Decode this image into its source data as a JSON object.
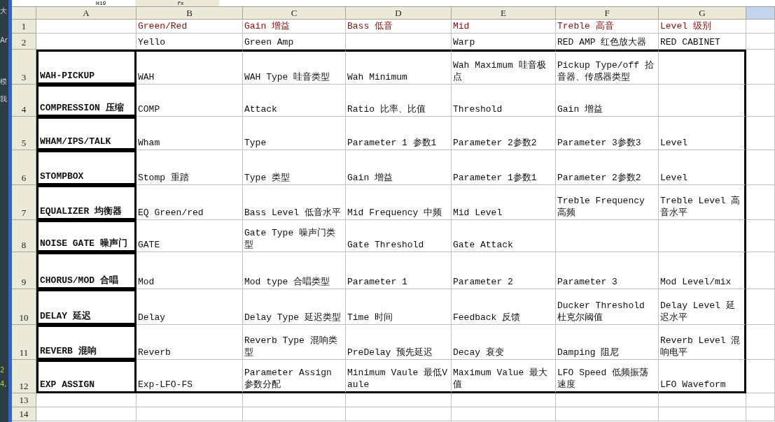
{
  "formula_bar": {
    "name_box": "H19",
    "function_label": "fx"
  },
  "side_panel": {
    "fragments": [
      "大",
      "Ar",
      "模",
      "我",
      "2",
      "4,"
    ]
  },
  "columns": [
    {
      "label": "A",
      "selected": false
    },
    {
      "label": "B",
      "selected": false
    },
    {
      "label": "C",
      "selected": false
    },
    {
      "label": "D",
      "selected": false
    },
    {
      "label": "E",
      "selected": false
    },
    {
      "label": "F",
      "selected": false
    },
    {
      "label": "G",
      "selected": false
    }
  ],
  "extra_column": {
    "selected": true
  },
  "rows": [
    {
      "number": "1",
      "kind": "title",
      "cells": [
        null,
        "Green/Red",
        "Gain 增益",
        "Bass 低音",
        "Mid",
        "Treble 高音",
        "Level 级别"
      ]
    },
    {
      "number": "2",
      "kind": "plain",
      "cells": [
        null,
        "Yello",
        "Green Amp",
        null,
        "Warp",
        "RED AMP 红色放大器",
        "RED CABINET"
      ]
    },
    {
      "number": "3",
      "kind": "effect",
      "cells": [
        "WAH-PICKUP",
        "WAH",
        "WAH Type 哇音类型",
        "Wah Minimum",
        "Wah Maximum 哇音极点",
        "Pickup Type/off 拾音器、传感器类型",
        null
      ]
    },
    {
      "number": "4",
      "kind": "effect",
      "cells": [
        "COMPRESSION 压缩",
        "COMP",
        "Attack",
        "Ratio 比率、比值",
        "Threshold",
        "Gain 增益",
        null
      ]
    },
    {
      "number": "5",
      "kind": "effect",
      "cells": [
        "WHAM/IPS/TALK",
        "Wham",
        "Type",
        "Parameter 1 参数1",
        "Parameter 2参数2",
        "Parameter 3参数3",
        "Level"
      ]
    },
    {
      "number": "6",
      "kind": "effect",
      "cells": [
        "STOMPBOX",
        "Stomp 重踏",
        "Type 类型",
        "Gain 增益",
        "Parameter 1参数1",
        "Parameter 2参数2",
        "Level"
      ]
    },
    {
      "number": "7",
      "kind": "effect",
      "cells": [
        "EQUALIZER 均衡器",
        "EQ Green/red",
        "Bass Level 低音水平",
        "Mid Frequency 中频",
        "Mid Level",
        "Treble Frequency 高频",
        "Treble Level 高音水平"
      ]
    },
    {
      "number": "8",
      "kind": "effect",
      "cells": [
        "NOISE GATE 噪声门",
        "GATE",
        "Gate Type 噪声门类型",
        "Gate Threshold",
        "Gate Attack",
        null,
        null
      ]
    },
    {
      "number": "9",
      "kind": "effect",
      "cells": [
        "CHORUS/MOD 合唱",
        "Mod",
        "Mod type 合唱类型",
        "Parameter 1",
        "Parameter 2",
        "Parameter 3",
        "Mod Level/mix"
      ]
    },
    {
      "number": "10",
      "kind": "effect",
      "cells": [
        "DELAY 延迟",
        "Delay",
        "Delay Type 延迟类型",
        "Time  时间",
        "Feedback 反馈",
        "Ducker Threshold 杜克尔阈值",
        "Delay Level 延迟水平"
      ]
    },
    {
      "number": "11",
      "kind": "effect",
      "cells": [
        "REVERB 混响",
        "Reverb",
        "Reverb Type 混响类型",
        "PreDelay 预先延迟",
        "Decay 衰变",
        "Damping 阻尼",
        "Reverb Level 混响电平"
      ]
    },
    {
      "number": "12",
      "kind": "effect",
      "cells": [
        "EXP ASSIGN",
        "Exp-LFO-FS",
        "Parameter Assign 参数分配",
        "Minimum Vaule 最低Vaule",
        "Maximum Value 最大值",
        "LFO Speed 低频振荡速度",
        "LFO Waveform"
      ]
    },
    {
      "number": "13",
      "kind": "plain"
    },
    {
      "number": "14",
      "kind": "plain"
    }
  ]
}
